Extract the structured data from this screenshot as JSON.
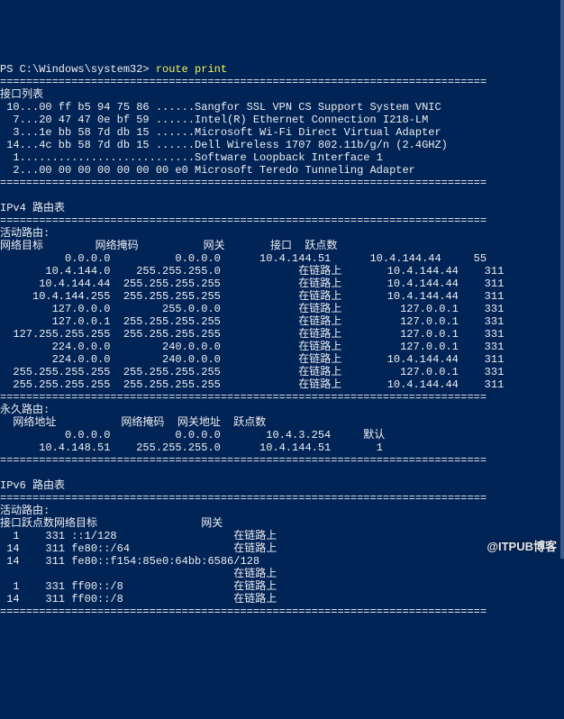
{
  "prompt": "PS C:\\Windows\\system32> ",
  "command": "route print",
  "divider": "===========================================================================",
  "interfaceList": {
    "title": "接口列表",
    "rows": [
      " 10...00 ff b5 94 75 86 ......Sangfor SSL VPN CS Support System VNIC",
      "  7...20 47 47 0e bf 59 ......Intel(R) Ethernet Connection I218-LM",
      "  3...1e bb 58 7d db 15 ......Microsoft Wi-Fi Direct Virtual Adapter",
      " 14...4c bb 58 7d db 15 ......Dell Wireless 1707 802.11b/g/n (2.4GHZ)",
      "  1...........................Software Loopback Interface 1",
      "  2...00 00 00 00 00 00 00 e0 Microsoft Teredo Tunneling Adapter"
    ]
  },
  "ipv4": {
    "title": "IPv4 路由表",
    "activeTitle": "活动路由:",
    "headers": "网络目标        网络掩码          网关       接口  跃点数",
    "routes": [
      "          0.0.0.0          0.0.0.0      10.4.144.51      10.4.144.44     55",
      "       10.4.144.0    255.255.255.0            在链路上       10.4.144.44    311",
      "      10.4.144.44  255.255.255.255            在链路上       10.4.144.44    311",
      "     10.4.144.255  255.255.255.255            在链路上       10.4.144.44    311",
      "        127.0.0.0        255.0.0.0            在链路上         127.0.0.1    331",
      "        127.0.0.1  255.255.255.255            在链路上         127.0.0.1    331",
      "  127.255.255.255  255.255.255.255            在链路上         127.0.0.1    331",
      "        224.0.0.0        240.0.0.0            在链路上         127.0.0.1    331",
      "        224.0.0.0        240.0.0.0            在链路上       10.4.144.44    311",
      "  255.255.255.255  255.255.255.255            在链路上         127.0.0.1    331",
      "  255.255.255.255  255.255.255.255            在链路上       10.4.144.44    311"
    ],
    "persistentTitle": "永久路由:",
    "persistentHeaders": "  网络地址          网络掩码  网关地址  跃点数",
    "persistentRoutes": [
      "          0.0.0.0          0.0.0.0       10.4.3.254     默认 ",
      "      10.4.148.51    255.255.255.0      10.4.144.51       1"
    ]
  },
  "ipv6": {
    "title": "IPv6 路由表",
    "activeTitle": "活动路由:",
    "headers": "接口跃点数网络目标                网关",
    "routes": [
      "  1    331 ::1/128                  在链路上",
      " 14    311 fe80::/64                在链路上",
      " 14    311 fe80::f154:85e0:64bb:6586/128",
      "                                    在链路上",
      "  1    331 ff00::/8                 在链路上",
      " 14    311 ff00::/8                 在链路上"
    ]
  },
  "watermark": "@ITPUB博客"
}
